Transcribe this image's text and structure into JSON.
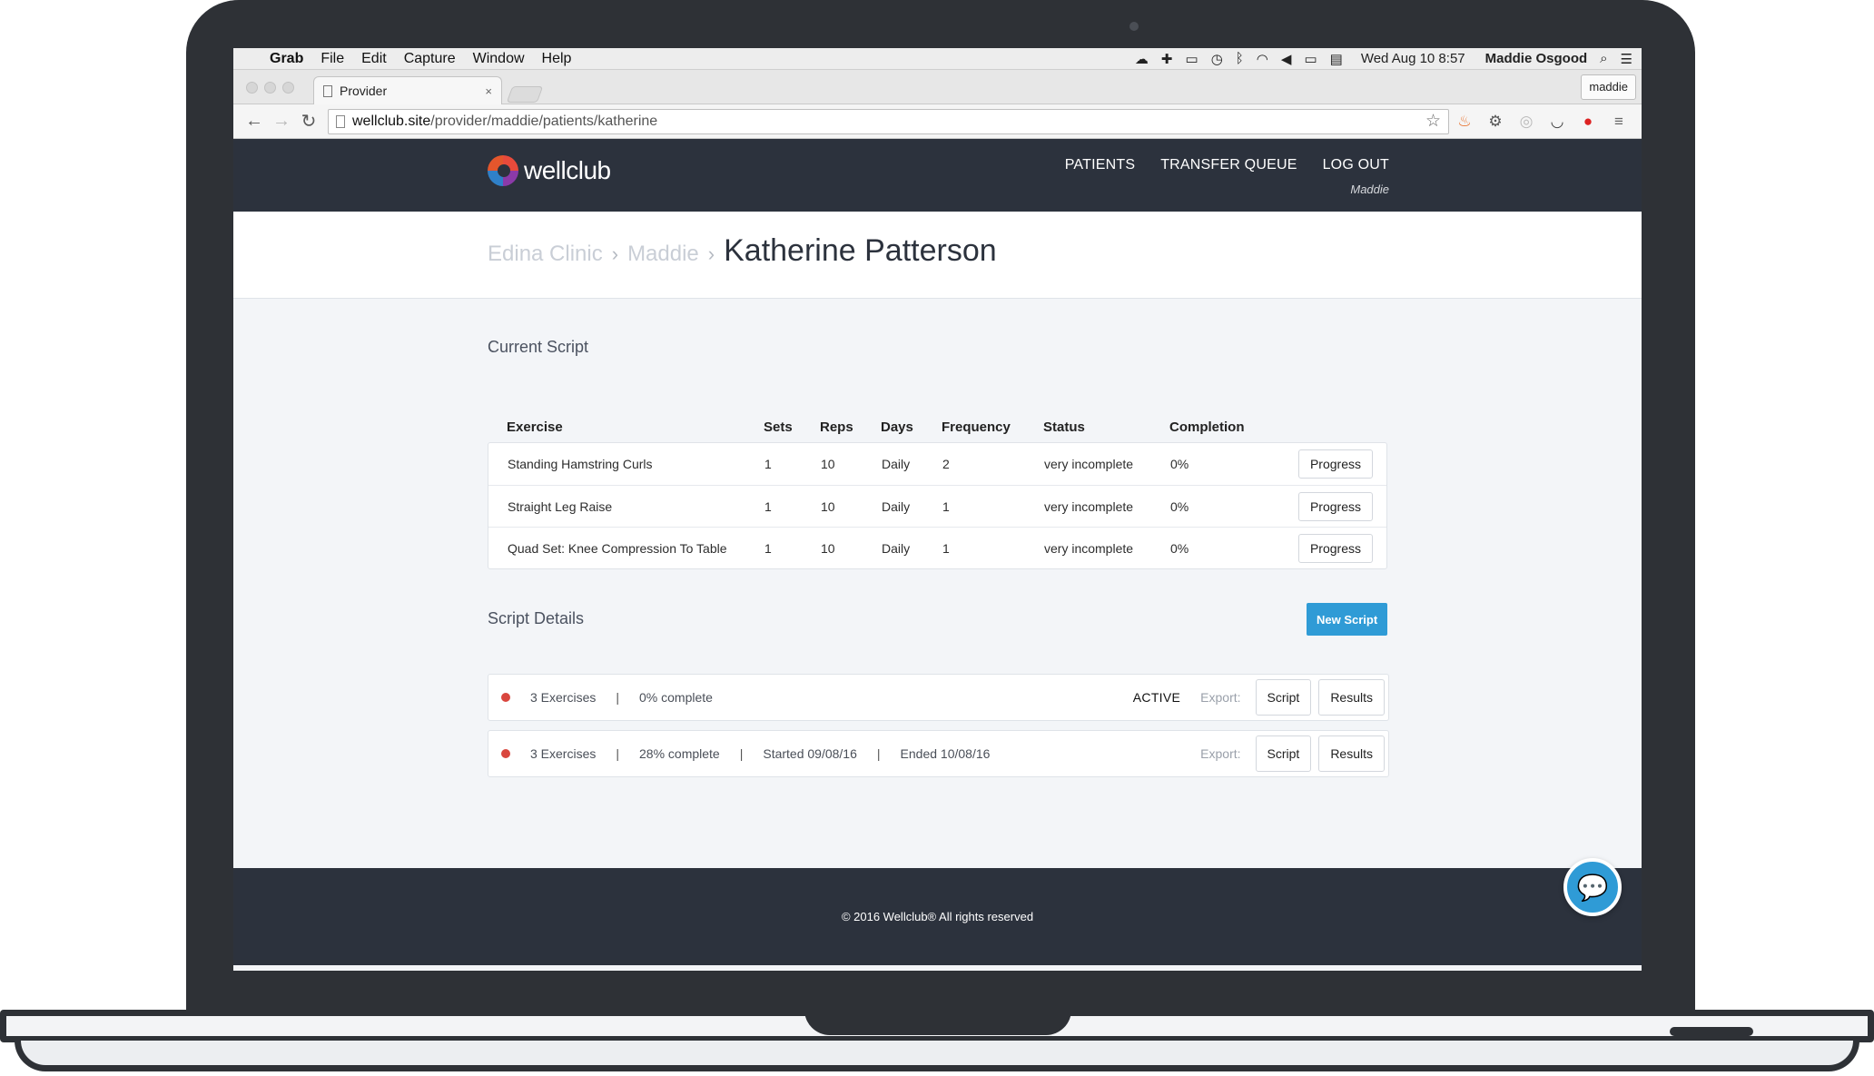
{
  "menubar": {
    "app_name": "Grab",
    "items": [
      "File",
      "Edit",
      "Capture",
      "Window",
      "Help"
    ],
    "clock": "Wed Aug 10  8:57",
    "user": "Maddie Osgood"
  },
  "browser": {
    "tab_title": "Provider",
    "tab_close": "×",
    "profile_label": "maddie",
    "url_host": "wellclub.site",
    "url_path": "/provider/maddie/patients/katherine"
  },
  "site": {
    "logo_text": "wellclub",
    "nav": {
      "patients": "PATIENTS",
      "transfer_queue": "TRANSFER QUEUE",
      "log_out": "LOG OUT",
      "user_name": "Maddie"
    },
    "breadcrumb": {
      "clinic": "Edina Clinic",
      "provider": "Maddie",
      "separator": "›",
      "patient": "Katherine Patterson"
    }
  },
  "current_script": {
    "title": "Current Script",
    "columns": {
      "exercise": "Exercise",
      "sets": "Sets",
      "reps": "Reps",
      "days": "Days",
      "frequency": "Frequency",
      "status": "Status",
      "completion": "Completion"
    },
    "rows": [
      {
        "exercise": "Standing Hamstring Curls",
        "sets": "1",
        "reps": "10",
        "days": "Daily",
        "frequency": "2",
        "status": "very incomplete",
        "completion": "0%",
        "action": "Progress"
      },
      {
        "exercise": "Straight Leg Raise",
        "sets": "1",
        "reps": "10",
        "days": "Daily",
        "frequency": "1",
        "status": "very incomplete",
        "completion": "0%",
        "action": "Progress"
      },
      {
        "exercise": "Quad Set: Knee Compression To Table",
        "sets": "1",
        "reps": "10",
        "days": "Daily",
        "frequency": "1",
        "status": "very incomplete",
        "completion": "0%",
        "action": "Progress"
      }
    ]
  },
  "script_details": {
    "title": "Script Details",
    "new_script_label": "New Script",
    "export_label": "Export:",
    "script_btn": "Script",
    "results_btn": "Results",
    "entries": [
      {
        "exercises": "3 Exercises",
        "complete": "0% complete",
        "state": "ACTIVE"
      },
      {
        "exercises": "3 Exercises",
        "complete": "28% complete",
        "started": "Started 09/08/16",
        "ended": "Ended 10/08/16"
      }
    ]
  },
  "footer": {
    "copyright": "© 2016 Wellclub® All rights reserved"
  },
  "colors": {
    "header_bg": "#2c323d",
    "accent_blue": "#2f9bd6",
    "status_dot_red": "#d9463e"
  },
  "icons": [
    "apple-icon",
    "search-icon",
    "menu-icon",
    "back-icon",
    "forward-icon",
    "reload-icon",
    "star-icon",
    "chat-icon"
  ]
}
